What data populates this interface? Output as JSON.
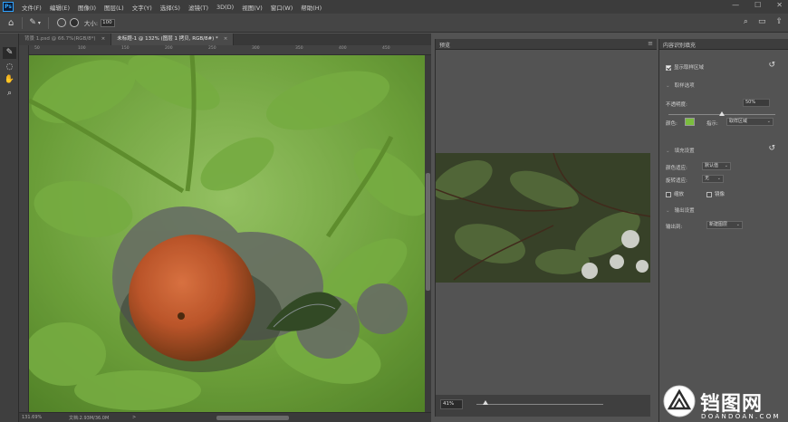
{
  "app": {
    "logo": "Ps"
  },
  "menu": [
    "文件(F)",
    "编辑(E)",
    "图像(I)",
    "图层(L)",
    "文字(Y)",
    "选择(S)",
    "滤镜(T)",
    "3D(D)",
    "视图(V)",
    "窗口(W)",
    "帮助(H)"
  ],
  "window_controls": {
    "minimize": "—",
    "maximize": "☐",
    "close": "✕"
  },
  "options_bar": {
    "size_label": "大小:",
    "size_value": "100"
  },
  "tabs": [
    {
      "label": "背景 1.psd @ 66.7%(RGB/8*)",
      "close": "×",
      "active": false
    },
    {
      "label": "未标题-1 @ 132% (图层 1 拷贝, RGB/8#) *",
      "close": "×",
      "active": true
    }
  ],
  "ruler_labels": [
    "50",
    "100",
    "150",
    "200",
    "250",
    "300",
    "350",
    "400",
    "450"
  ],
  "status": {
    "zoom": "131.69%",
    "doc": "文档:2.93M/36.0M",
    "arrow": ">"
  },
  "preview_panel": {
    "title": "预览",
    "menu": "≡",
    "zoom": "41%",
    "zoom_level": 0.07
  },
  "properties_panel": {
    "title": "内容识别填充",
    "show_sampling_label": "显示取样区域",
    "show_sampling_checked": true,
    "sampling_section": "取样选项",
    "opacity_label": "不透明度:",
    "opacity_value": "50%",
    "opacity_level": 0.5,
    "color_label": "颜色:",
    "sampling_color": "#7bbd3e",
    "indicates_label": "指示:",
    "indicates_value": "取样区域",
    "fill_section": "填充设置",
    "color_adapt_label": "颜色适应:",
    "color_adapt_value": "默认值",
    "rotation_adapt_label": "旋转适应:",
    "rotation_adapt_value": "无",
    "scale_label": "缩放",
    "mirror_label": "镜像",
    "output_section": "输出设置",
    "output_to_label": "输出到:",
    "output_to_value": "新建图层"
  },
  "watermark": {
    "title": "铛图网",
    "subtitle": "DOANDOAN.COM"
  }
}
